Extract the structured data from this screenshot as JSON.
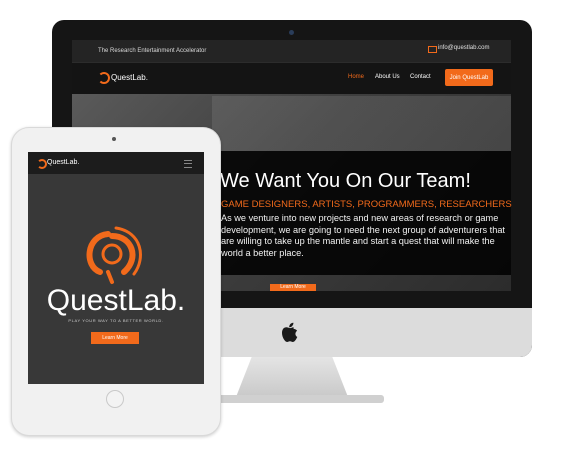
{
  "desktop": {
    "tagline": "The Research Entertainment Accelerator",
    "email": "info@questlab.com",
    "logo": "QuestLab.",
    "nav": [
      "Home",
      "About Us",
      "Contact"
    ],
    "active_nav": "Home",
    "cta": "Join QuestLab",
    "hero_title": "We Want You On Our Team!",
    "hero_subtitle": "GAME DESIGNERS, ARTISTS, PROGRAMMERS, RESEARCHERS",
    "hero_body": "As we venture into new projects and new areas of research or game development, we are going to need the next group of adventurers that are willing to take up the mantle and start a quest that will make the world a better place.",
    "hero_button": "Learn More"
  },
  "tablet": {
    "logo": "QuestLab.",
    "brand": "QuestLab.",
    "tagline": "PLAY YOUR WAY TO A BETTER WORLD.",
    "button": "Learn More"
  },
  "colors": {
    "accent": "#f26a1b",
    "dark": "#1e1e1e"
  },
  "icons": [
    "mail-icon",
    "hamburger-icon",
    "apple-logo-icon",
    "questlab-logo-icon"
  ]
}
